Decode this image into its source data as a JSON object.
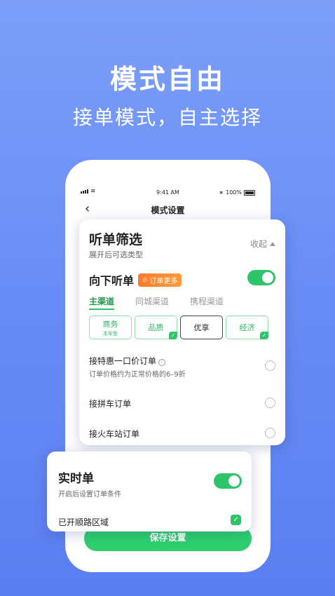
{
  "hero": {
    "title": "模式自由",
    "subtitle": "接单模式，自主选择"
  },
  "status_bar": {
    "time": "9:41 AM",
    "battery": "100%"
  },
  "nav": {
    "back_icon": "chevron-left-icon",
    "title": "模式设置"
  },
  "filter_card": {
    "title": "听单筛选",
    "description": "展开后可选类型",
    "collapse_label": "收起",
    "listen_down": {
      "label": "向下听单",
      "badge": "订单更多",
      "enabled": true
    },
    "tabs": [
      {
        "label": "主渠道",
        "active": true
      },
      {
        "label": "同城渠道",
        "active": false
      },
      {
        "label": "携程渠道",
        "active": false
      }
    ],
    "car_types": [
      {
        "label": "商务",
        "sub": "本车型",
        "checked": false
      },
      {
        "label": "品质",
        "sub": "",
        "checked": true
      },
      {
        "label": "优享",
        "sub": "",
        "checked": false
      },
      {
        "label": "经济",
        "sub": "",
        "checked": true
      }
    ],
    "options": [
      {
        "label": "接特惠一口价订单",
        "sub": "订单价格约为正常价格的6–9折",
        "selected": false
      },
      {
        "label": "接拼车订单",
        "sub": "",
        "selected": false
      },
      {
        "label": "接火车站订单",
        "sub": "",
        "selected": false
      }
    ]
  },
  "realtime_card": {
    "title": "实时单",
    "description": "开启后设置订单条件",
    "enabled": true,
    "route_area": {
      "label": "已开顺路区域",
      "checked": true
    }
  },
  "save_button": {
    "label": "保存设置"
  },
  "colors": {
    "accent_green": "#2ec468",
    "badge_orange": "#ff7a2a",
    "background_blue": "#6a8ef6"
  }
}
